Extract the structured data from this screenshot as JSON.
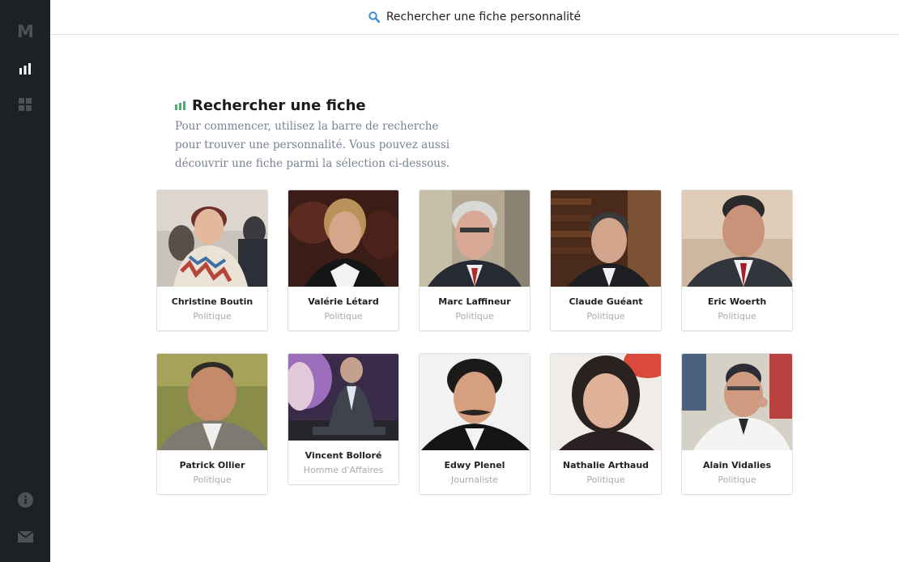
{
  "sidebar": {
    "logo": "M",
    "items": [
      {
        "icon": "chart-bars-icon",
        "active": true
      },
      {
        "icon": "grid-icon",
        "active": false
      }
    ],
    "bottom": [
      {
        "icon": "info-icon"
      },
      {
        "icon": "mail-icon"
      }
    ]
  },
  "search": {
    "placeholder": "Rechercher une fiche personnalité",
    "icon": "search-icon",
    "icon_color": "#3b8ed6"
  },
  "intro": {
    "title": "Rechercher une fiche",
    "description": "Pour commencer, utilisez la barre de recherche pour trouver une personnalité. Vous pouvez aussi découvrir une fiche parmi la sélection ci-dessous.",
    "accent_color": "#4caf6e"
  },
  "people": [
    {
      "name": "Christine Boutin",
      "role": "Politique"
    },
    {
      "name": "Valérie Létard",
      "role": "Politique"
    },
    {
      "name": "Marc Laffineur",
      "role": "Politique"
    },
    {
      "name": "Claude Guéant",
      "role": "Politique"
    },
    {
      "name": "Eric Woerth",
      "role": "Politique"
    },
    {
      "name": "Patrick Ollier",
      "role": "Politique"
    },
    {
      "name": "Vincent Bolloré",
      "role": "Homme d'Affaires"
    },
    {
      "name": "Edwy Plenel",
      "role": "Journaliste"
    },
    {
      "name": "Nathalie Arthaud",
      "role": "Politique"
    },
    {
      "name": "Alain Vidalies",
      "role": "Politique"
    }
  ]
}
